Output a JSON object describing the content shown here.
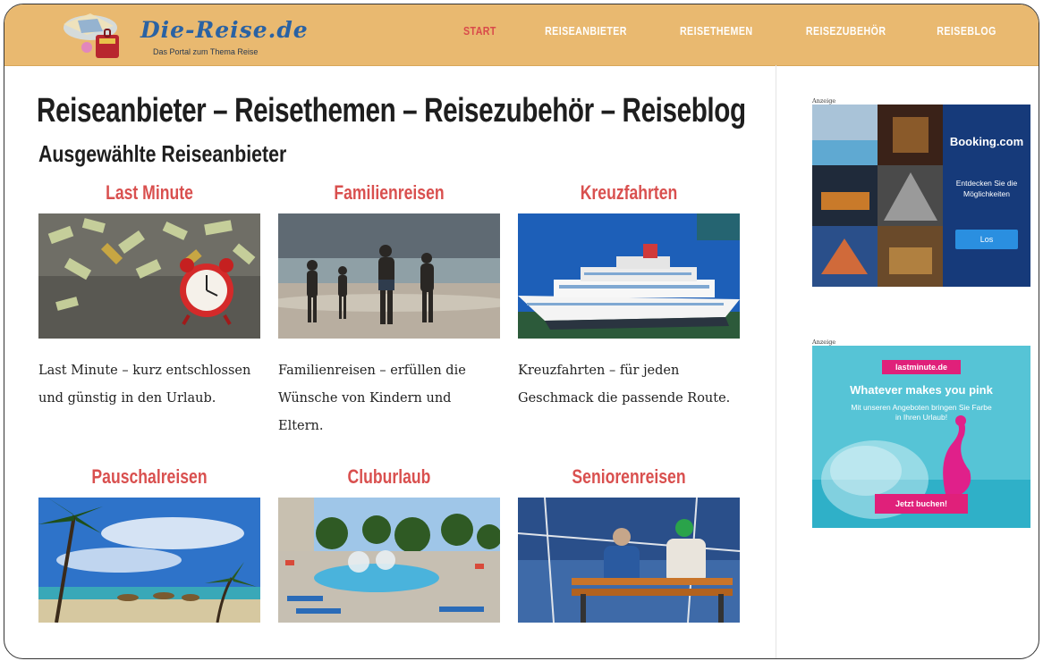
{
  "site": {
    "logo_title": "Die-Reise.de",
    "tagline": "Das Portal zum Thema Reise"
  },
  "nav": [
    {
      "label": "START",
      "active": true
    },
    {
      "label": "REISEANBIETER",
      "active": false
    },
    {
      "label": "REISETHEMEN",
      "active": false
    },
    {
      "label": "REISEZUBEHÖR",
      "active": false
    },
    {
      "label": "REISEBLOG",
      "active": false
    }
  ],
  "main": {
    "heading": "Reiseanbieter – Reisethemen – Reisezubehör – Reiseblog",
    "subheading": "Ausgewählte Reiseanbieter",
    "cards": [
      {
        "title": "Last Minute",
        "description": "Last Minute – kurz entschlossen und günstig in den Urlaub.",
        "image": "alarm-clock-money-photo"
      },
      {
        "title": "Familienreisen",
        "description": "Familienreisen – erfüllen die Wünsche von Kindern und Eltern.",
        "image": "family-beach-photo"
      },
      {
        "title": "Kreuzfahrten",
        "description": "Kreuzfahrten – für jeden Geschmack die passende Route.",
        "image": "cruise-ship-photo"
      },
      {
        "title": "Pauschalreisen",
        "description": "",
        "image": "palm-beach-photo"
      },
      {
        "title": "Cluburlaub",
        "description": "",
        "image": "club-pool-photo"
      },
      {
        "title": "Seniorenreisen",
        "description": "",
        "image": "seniors-bench-photo"
      }
    ]
  },
  "ads": [
    {
      "label": "Anzeige",
      "brand": "Booking.com",
      "text": "Entdecken Sie die Möglichkeiten",
      "button": "Los",
      "colors": {
        "bg": "#163a7a",
        "button": "#2a8fe0"
      }
    },
    {
      "label": "Anzeige",
      "brand": "lastminute.de",
      "headline": "Whatever makes you pink",
      "text": "Mit unseren Angeboten bringen Sie Farbe in Ihren Urlaub!",
      "button": "Jetzt buchen!",
      "colors": {
        "bg": "#4cc6d8",
        "accent": "#e0207a"
      }
    }
  ],
  "colors": {
    "header_bg": "#e9b970",
    "nav_active": "#d94a4a",
    "card_title": "#d9504f"
  }
}
